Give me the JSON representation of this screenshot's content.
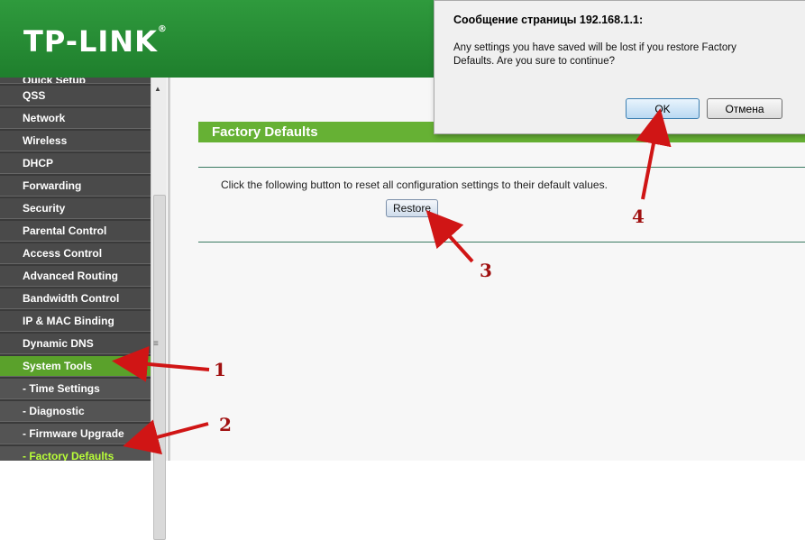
{
  "header": {
    "logo_text": "TP-LINK",
    "logo_mark": "®"
  },
  "sidebar": {
    "partial_label": "Quick Setup",
    "items": [
      {
        "label": "QSS"
      },
      {
        "label": "Network"
      },
      {
        "label": "Wireless"
      },
      {
        "label": "DHCP"
      },
      {
        "label": "Forwarding"
      },
      {
        "label": "Security"
      },
      {
        "label": "Parental Control"
      },
      {
        "label": "Access Control"
      },
      {
        "label": "Advanced Routing"
      },
      {
        "label": "Bandwidth Control"
      },
      {
        "label": "IP & MAC Binding"
      },
      {
        "label": "Dynamic DNS"
      },
      {
        "label": "System Tools"
      },
      {
        "label": "- Time Settings"
      },
      {
        "label": "- Diagnostic"
      },
      {
        "label": "- Firmware Upgrade"
      },
      {
        "label": "- Factory Defaults"
      }
    ]
  },
  "main": {
    "title": "Factory Defaults",
    "description": "Click the following button to reset all configuration settings to their default values.",
    "restore_label": "Restore"
  },
  "dialog": {
    "title": "Сообщение страницы 192.168.1.1:",
    "message": "Any settings you have saved will be lost if you restore Factory Defaults. Are you sure to continue?",
    "ok_label": "OK",
    "cancel_label": "Отмена"
  },
  "annotations": {
    "n1": "1",
    "n2": "2",
    "n3": "3",
    "n4": "4"
  },
  "colors": {
    "header_green": "#2f9a3d",
    "active_green": "#5aa12b",
    "title_green": "#66b134",
    "arrow_red": "#d01515"
  }
}
